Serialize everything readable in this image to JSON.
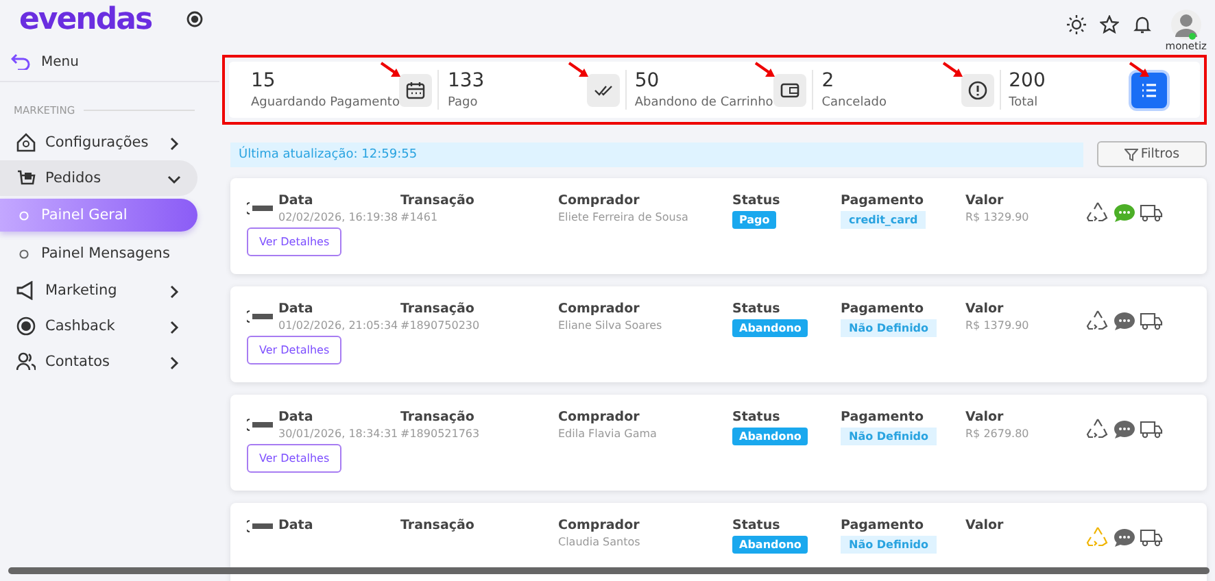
{
  "header": {
    "logo": "evendas",
    "user": {
      "name": "monetiz",
      "online": true
    }
  },
  "sidebar": {
    "back": "Menu",
    "section": "MARKETING",
    "items": [
      {
        "label": "Configurações",
        "kind": "house",
        "expanded": false
      },
      {
        "label": "Pedidos",
        "kind": "cart",
        "expanded": true,
        "children": [
          {
            "label": "Painel Geral",
            "selected": true
          },
          {
            "label": "Painel Mensagens",
            "selected": false
          }
        ]
      },
      {
        "label": "Marketing",
        "kind": "megaphone",
        "expanded": false
      },
      {
        "label": "Cashback",
        "kind": "coin",
        "expanded": false
      },
      {
        "label": "Contatos",
        "kind": "people",
        "expanded": false
      }
    ]
  },
  "stats": [
    {
      "value": "15",
      "label": "Aguardando Pagamento",
      "kind": "calendar",
      "selected": false
    },
    {
      "value": "133",
      "label": "Pago",
      "kind": "checks",
      "selected": false
    },
    {
      "value": "50",
      "label": "Abandono de Carrinho",
      "kind": "wallet",
      "selected": false
    },
    {
      "value": "2",
      "label": "Cancelado",
      "kind": "alert",
      "selected": false
    },
    {
      "value": "200",
      "label": "Total",
      "kind": "list",
      "selected": true
    }
  ],
  "last_update": "Última atualização: 12:59:55",
  "filter_button": "Filtros",
  "orders": [
    {
      "date_label": "Data",
      "date": "02/02/2026, 16:19:38",
      "tx_label": "Transação",
      "tx": "#1461",
      "buyer_label": "Comprador",
      "buyer": "Eliete Ferreira de Sousa",
      "status_label": "Status",
      "status": "Pago",
      "payment_label": "Pagamento",
      "payment": "credit_card",
      "value_label": "Valor",
      "value": "R$ 1329.90",
      "details": "Ver Detalhes",
      "chat_active": true,
      "recycle_active": false
    },
    {
      "date_label": "Data",
      "date": "01/02/2026, 21:05:34",
      "tx_label": "Transação",
      "tx": "#1890750230",
      "buyer_label": "Comprador",
      "buyer": "Eliane Silva Soares",
      "status_label": "Status",
      "status": "Abandono",
      "payment_label": "Pagamento",
      "payment": "Não Definido",
      "value_label": "Valor",
      "value": "R$ 1379.90",
      "details": "Ver Detalhes",
      "chat_active": false,
      "recycle_active": false
    },
    {
      "date_label": "Data",
      "date": "30/01/2026, 18:34:31",
      "tx_label": "Transação",
      "tx": "#1890521763",
      "buyer_label": "Comprador",
      "buyer": "Edila Flavia Gama",
      "status_label": "Status",
      "status": "Abandono",
      "payment_label": "Pagamento",
      "payment": "Não Definido",
      "value_label": "Valor",
      "value": "R$ 2679.80",
      "details": "Ver Detalhes",
      "chat_active": false,
      "recycle_active": false
    },
    {
      "date_label": "Data",
      "tx_label": "Transação",
      "buyer_label": "Comprador",
      "buyer": "Claudia Santos",
      "status_label": "Status",
      "status": "Abandono",
      "payment_label": "Pagamento",
      "payment": "Não Definido",
      "value_label": "Valor",
      "chat_active": false,
      "recycle_active": true
    }
  ]
}
